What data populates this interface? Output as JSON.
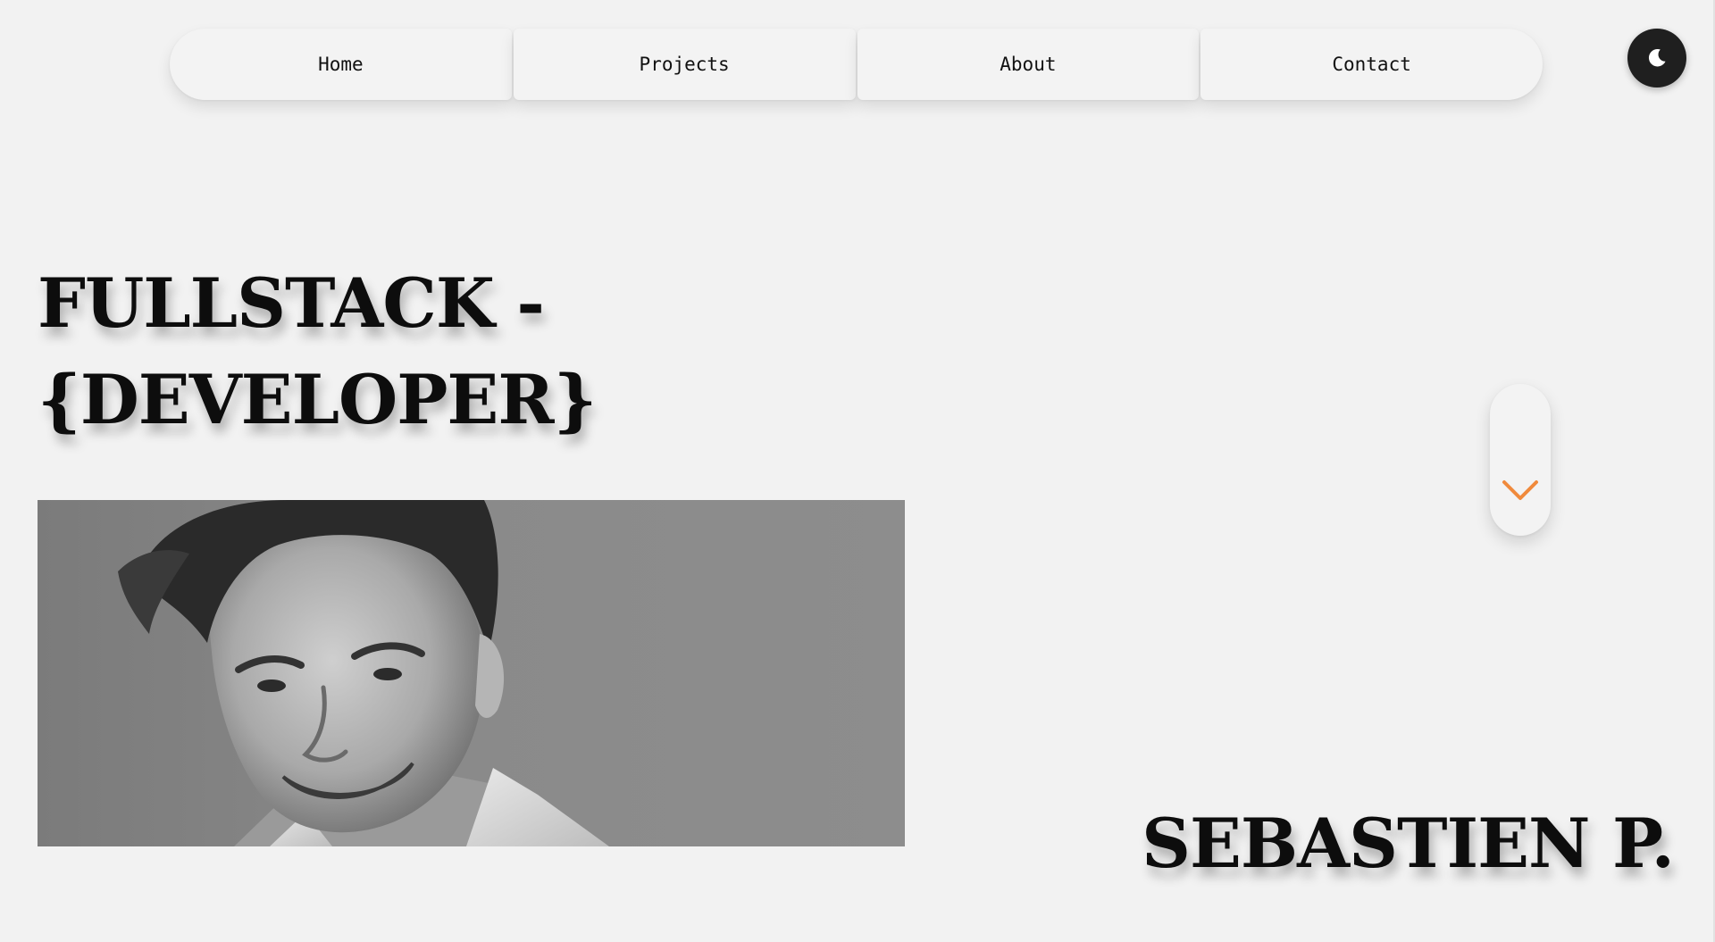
{
  "nav": {
    "items": [
      {
        "label": "Home"
      },
      {
        "label": "Projects"
      },
      {
        "label": "About"
      },
      {
        "label": "Contact"
      }
    ]
  },
  "theme_toggle": {
    "icon": "moon-icon"
  },
  "hero": {
    "headline_line1": "FULLSTACK -",
    "headline_line2": "{DEVELOPER}",
    "portrait_icon": "portrait-photo",
    "scroll_icon": "chevron-down-icon",
    "name": "SEBASTIEN P."
  },
  "colors": {
    "background": "#f2f2f2",
    "accent": "#f08a3c",
    "toggle_bg": "#1f1f1f",
    "text": "#0d0d0d"
  }
}
